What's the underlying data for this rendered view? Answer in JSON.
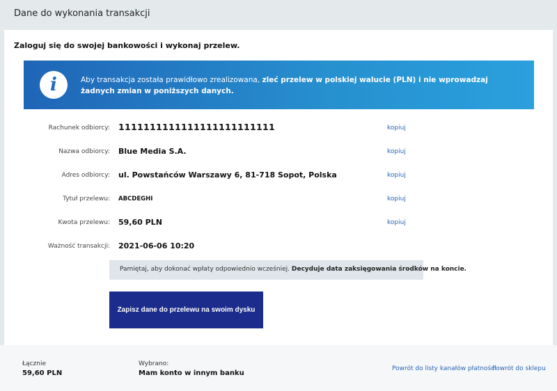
{
  "header": {
    "title": "Dane do wykonania transakcji"
  },
  "intro": "Zaloguj się do swojej bankowości i wykonaj przelew.",
  "banner": {
    "text_regular": "Aby transakcja została prawidłowo zrealizowana, ",
    "text_bold": "zleć przelew w polskiej walucie (PLN) i nie wprowadzaj żadnych zmian w poniższych danych.",
    "icon": "info-icon"
  },
  "rows": [
    {
      "label": "Rachunek odbiorcy:",
      "value": "1111111111111111111111111",
      "copy": "kopiuj"
    },
    {
      "label": "Nazwa odbiorcy:",
      "value": "Blue Media S.A.",
      "copy": "kopiuj"
    },
    {
      "label": "Adres odbiorcy:",
      "value": "ul. Powstańców Warszawy 6, 81-718 Sopot, Polska",
      "copy": "kopiuj"
    },
    {
      "label": "Tytuł przelewu:",
      "value": "ABCDEGHI",
      "copy": "kopiuj"
    },
    {
      "label": "Kwota przelewu:",
      "value": "59,60 PLN",
      "copy": "kopiuj"
    },
    {
      "label": "Ważność transakcji:",
      "value": "2021-06-06 10:20"
    }
  ],
  "notice": {
    "text_regular": "Pamiętaj, aby dokonać wpłaty odpowiednio wcześniej. ",
    "text_bold": "Decyduje data zaksięgowania środków na koncie."
  },
  "save_button": "Zapisz dane do przelewu na swoim dysku",
  "footer": {
    "total_label": "Łącznie",
    "total_value": "59,60 PLN",
    "chosen_label": "Wybrano:",
    "chosen_value": "Mam konto w innym banku",
    "link_channels": "Powrót do listy kanałów płatności",
    "link_shop": "Powrót do sklepu"
  },
  "colors": {
    "accent": "#1b2c8c",
    "banner_start": "#1f65b7",
    "banner_end": "#2aa0dd",
    "link": "#2b66b3"
  }
}
